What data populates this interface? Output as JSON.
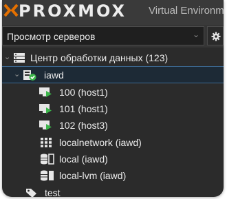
{
  "header": {
    "brand_name": "PROXMOX",
    "brand_subtitle": "Virtual Environment"
  },
  "toolbar": {
    "view_selected": "Просмотр серверов",
    "gear_icon": "gear-icon"
  },
  "tree": {
    "datacenter": {
      "label": "Центр обработки данных (123)",
      "icon": "server-stack-icon"
    },
    "node": {
      "label": "iawd",
      "icon": "node-online-icon"
    },
    "guests": [
      {
        "label": "100 (host1)",
        "icon": "vm-running-icon"
      },
      {
        "label": "101 (host1)",
        "icon": "vm-running-icon"
      },
      {
        "label": "102 (host3)",
        "icon": "vm-running-icon"
      }
    ],
    "network": {
      "label": "localnetwork (iawd)",
      "icon": "network-grid-icon"
    },
    "storages": [
      {
        "label": "local (iawd)",
        "icon": "storage-icon"
      },
      {
        "label": "local-lvm (iawd)",
        "icon": "storage-icon"
      }
    ],
    "tag": {
      "label": "test",
      "icon": "tag-icon"
    }
  },
  "colors": {
    "accent_green": "#3bb54a",
    "brand_orange": "#e57000",
    "selection_border": "#3d6a93"
  }
}
